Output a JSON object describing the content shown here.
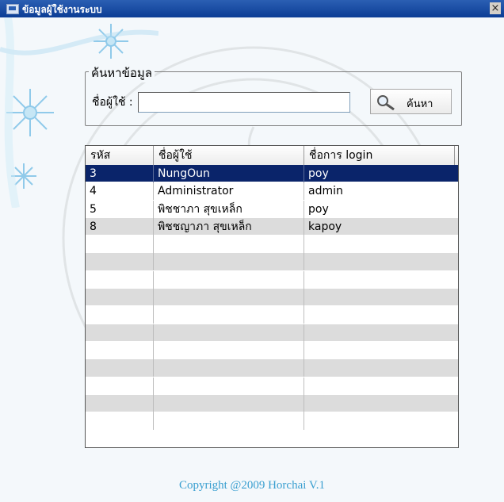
{
  "window": {
    "title": "ข้อมูลผู้ใช้งานระบบ",
    "close_symbol": "×"
  },
  "search": {
    "group_label": "ค้นหาข้อมูล",
    "field_label": "ชื่อผู้ใช้ :",
    "value": "",
    "button_label": "ค้นหา",
    "button_icon": "magnifier-icon"
  },
  "grid": {
    "columns": [
      "รหัส",
      "ชื่อผู้ใช้",
      "ชื่อการ login"
    ],
    "rows": [
      {
        "id": "3",
        "name": "NungOun",
        "login": "poy"
      },
      {
        "id": "4",
        "name": "Administrator",
        "login": "admin"
      },
      {
        "id": "5",
        "name": "พิชชาภา สุขเหล็ก",
        "login": "poy"
      },
      {
        "id": "8",
        "name": "พิชชญาภา สุขเหล็ก",
        "login": "kapoy"
      }
    ],
    "selected_row": 0,
    "empty_row_count": 11
  },
  "footer": {
    "copyright": "Copyright @2009 Horchai V.1"
  },
  "colors": {
    "titlebar": "#0b3d95",
    "selection": "#0a246a",
    "alt_row": "#dcdcdc",
    "copyright": "#3a9fd0"
  }
}
